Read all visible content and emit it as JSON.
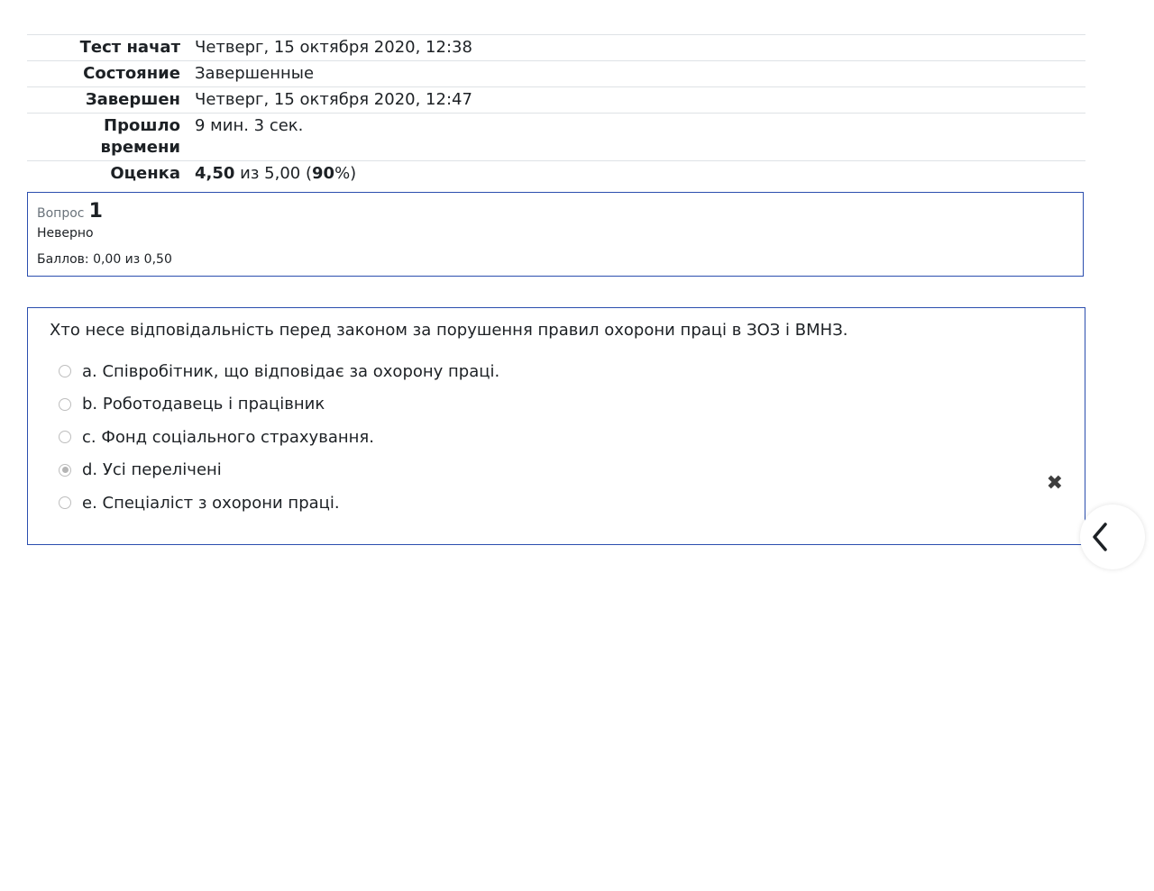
{
  "summary": {
    "rows": [
      {
        "label": "Тест начат",
        "value": "Четверг, 15 октября 2020, 12:38"
      },
      {
        "label": "Состояние",
        "value": "Завершенные"
      },
      {
        "label": "Завершен",
        "value": "Четверг, 15 октября 2020, 12:47"
      },
      {
        "label": "Прошло времени",
        "value": "9 мин. 3 сек."
      },
      {
        "label": "Оценка",
        "value": ""
      }
    ],
    "grade": {
      "score": "4,50",
      "of_text": "из 5,00",
      "percent": "90",
      "percent_suffix": "%)",
      "open_paren": "("
    }
  },
  "question": {
    "label": "Вопрос",
    "number": "1",
    "state": "Неверно",
    "grade": "Баллов: 0,00 из 0,50",
    "text": "Хто несе відповідальність перед законом за порушення правил охорони праці в ЗОЗ і ВМНЗ.",
    "answers": [
      {
        "text": "a. Співробітник, що відповідає за охорону праці.",
        "checked": false
      },
      {
        "text": "b. Роботодавець і працівник",
        "checked": false
      },
      {
        "text": "c. Фонд соціального страхування.",
        "checked": false
      },
      {
        "text": "d. Усі перелічені",
        "checked": true
      },
      {
        "text": "e. Спеціаліст з охорони праці.",
        "checked": false
      }
    ],
    "result_icon": "incorrect-cross-icon"
  },
  "drawer": {
    "icon": "chevron-left-icon"
  },
  "colors": {
    "border": "#2b4eae",
    "text": "#1d2125"
  }
}
